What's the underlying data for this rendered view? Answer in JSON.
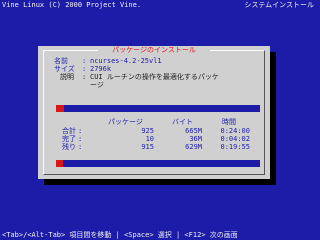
{
  "screen": {
    "title": "Vine Linux (C) 2000 Project Vine.",
    "banner": "システムインストール",
    "help": "<Tab>/<Alt-Tab> 項目間を移動 | <Space> 選択 | <F12> 次の画面"
  },
  "dialog": {
    "title": "パッケージのインストール",
    "name_label": "名前",
    "name_value": "ncurses-4.2-25vl1",
    "size_label": "サイズ",
    "size_value": "2796k",
    "summary_label": "説明",
    "summary_line1": "CUI ルーチンの操作を最適化するパッケ",
    "summary_line2": "ージ",
    "package_progress": 0.04,
    "total_progress": 0.02,
    "stats": {
      "headers": [
        "パッケージ",
        "バイト",
        "時間"
      ],
      "rows": [
        {
          "label": "合計",
          "packages": "925",
          "bytes": "665M",
          "time": "0:24:00"
        },
        {
          "label": "完了",
          "packages": "10",
          "bytes": "36M",
          "time": "0:04:02"
        },
        {
          "label": "残り",
          "packages": "915",
          "bytes": "629M",
          "time": "0:19:55"
        }
      ]
    }
  },
  "colors": {
    "background": "#1c1ca8",
    "dialog": "#d0d0d0",
    "progress": "#d61818",
    "title": "#e01818"
  }
}
